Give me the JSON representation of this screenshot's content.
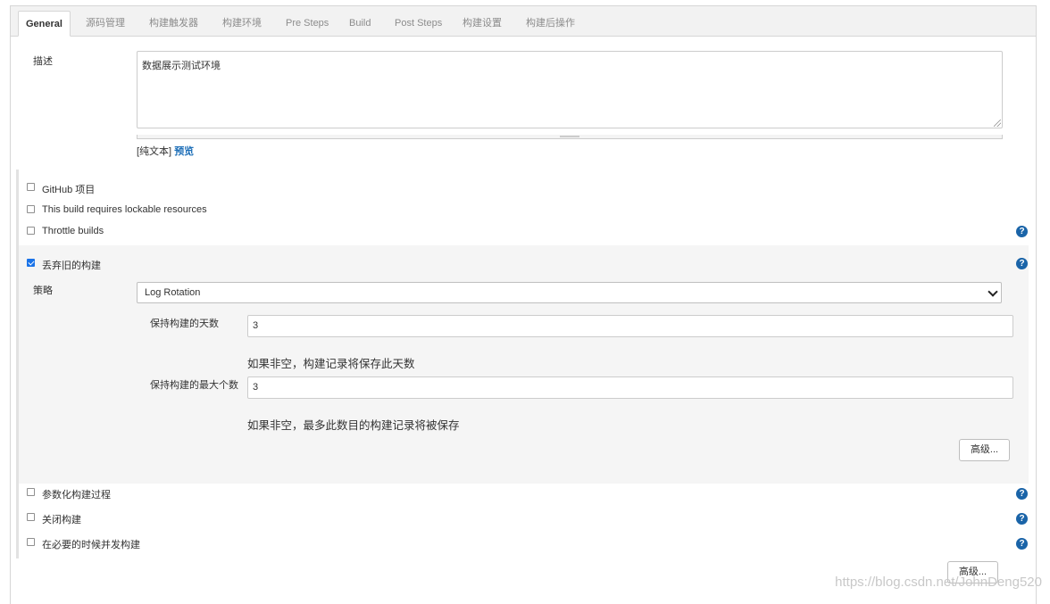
{
  "tabs": [
    "General",
    "源码管理",
    "构建触发器",
    "构建环境",
    "Pre Steps",
    "Build",
    "Post Steps",
    "构建设置",
    "构建后操作"
  ],
  "description": {
    "label": "描述",
    "value": "数据展示测试环境",
    "plain_text": "[纯文本]",
    "preview_link": "预览"
  },
  "options_top": [
    {
      "label": "GitHub 项目",
      "checked": false
    },
    {
      "label": "This build requires lockable resources",
      "checked": false
    },
    {
      "label": "Throttle builds",
      "checked": false
    }
  ],
  "discard": {
    "label": "丢弃旧的构建",
    "checked": true,
    "strategy_label": "策略",
    "strategy_value": "Log Rotation",
    "days_label": "保持构建的天数",
    "days_value": "3",
    "days_hint": "如果非空，构建记录将保存此天数",
    "max_label": "保持构建的最大个数",
    "max_value": "3",
    "max_hint": "如果非空，最多此数目的构建记录将被保存",
    "advanced_button": "高级..."
  },
  "options_bottom": [
    {
      "label": "参数化构建过程",
      "checked": false
    },
    {
      "label": "关闭构建",
      "checked": false
    },
    {
      "label": "在必要的时候并发构建",
      "checked": false
    }
  ],
  "advanced_button": "高级...",
  "help_glyph": "?",
  "watermark": "https://blog.csdn.net/JohnDeng520",
  "colors": {
    "accent": "#1a73e8",
    "help": "#1a64a8",
    "link": "#1e6fb8"
  }
}
